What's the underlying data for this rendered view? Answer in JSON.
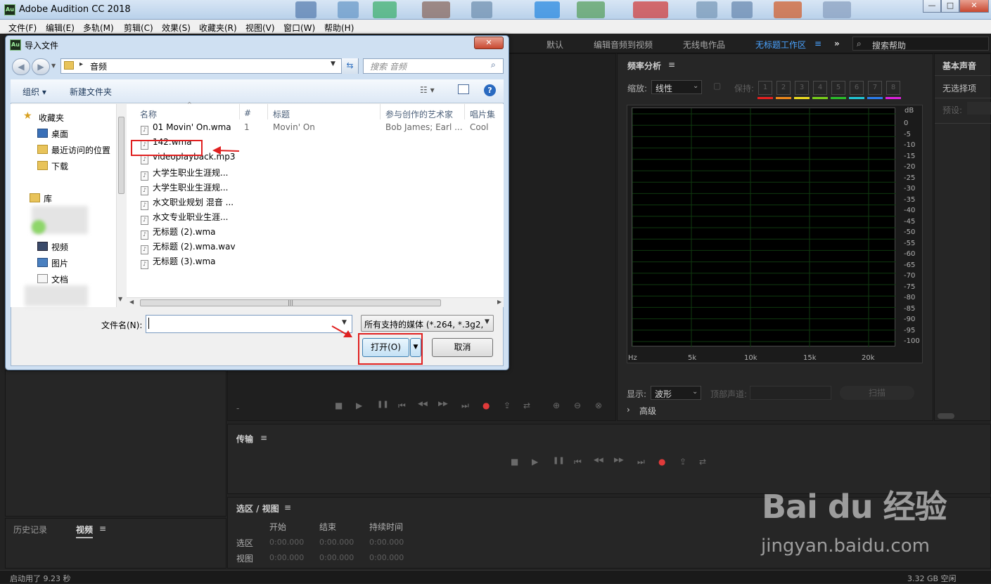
{
  "window": {
    "app_icon": "Au",
    "title": "Adobe Audition CC 2018",
    "min": "—",
    "max": "□",
    "close": "✕"
  },
  "menu": [
    "文件(F)",
    "编辑(E)",
    "多轨(M)",
    "剪辑(C)",
    "效果(S)",
    "收藏夹(R)",
    "视图(V)",
    "窗口(W)",
    "帮助(H)"
  ],
  "workspaces": {
    "items": [
      "默认",
      "编辑音频到视频",
      "无线电作品",
      "无标题工作区"
    ],
    "active_menu": "≡",
    "more": "»",
    "search_placeholder": "搜索帮助"
  },
  "freq_panel": {
    "title": "频率分析",
    "menu": "≡",
    "zoom_label": "缩放:",
    "zoom_value": "线性",
    "hold_label": "保持:",
    "hold_slots": [
      "1",
      "2",
      "3",
      "4",
      "5",
      "6",
      "7",
      "8"
    ],
    "hold_colors": [
      "#e82020",
      "#f28a1a",
      "#f0e020",
      "#7ad21a",
      "#2ac22a",
      "#20c8d8",
      "#2a7ef0",
      "#e020e0"
    ],
    "y_unit": "dB",
    "y_ticks": [
      "0",
      "-5",
      "-10",
      "-15",
      "-20",
      "-25",
      "-30",
      "-35",
      "-40",
      "-45",
      "-50",
      "-55",
      "-60",
      "-65",
      "-70",
      "-75",
      "-80",
      "-85",
      "-90",
      "-95",
      "-100"
    ],
    "x_ticks": [
      "Hz",
      "5k",
      "10k",
      "15k",
      "20k"
    ],
    "display_label": "显示:",
    "display_value": "波形",
    "top_channel_label": "顶部声道:",
    "scan_button": "扫描",
    "advanced": "高级"
  },
  "essential_panel": {
    "title": "基本声音",
    "no_selection": "无选择项",
    "preset_label": "预设:"
  },
  "transport_panel": {
    "title": "传输",
    "menu": "≡"
  },
  "selection_panel": {
    "title": "选区 / 视图",
    "menu": "≡",
    "headers": [
      "开始",
      "结束",
      "持续时间"
    ],
    "rows": [
      {
        "label": "选区",
        "start": "0:00.000",
        "end": "0:00.000",
        "duration": "0:00.000"
      },
      {
        "label": "视图",
        "start": "0:00.000",
        "end": "0:00.000",
        "duration": "0:00.000"
      }
    ]
  },
  "bottom_left": {
    "tabs": [
      "历史记录",
      "视频"
    ],
    "menu": "≡"
  },
  "status": {
    "left": "启动用了 9.23 秒",
    "right": "3.32 GB 空闲"
  },
  "transport_icons": [
    "■",
    "▶",
    "❚❚",
    "⏮",
    "◀◀",
    "▶▶",
    "⏭",
    "●",
    "⇪",
    "⇄"
  ],
  "dialog": {
    "icon": "Au",
    "title": "导入文件",
    "close": "✕",
    "breadcrumb_folder": "音频",
    "search_placeholder": "搜索 音频",
    "organize": "组织 ▾",
    "new_folder": "新建文件夹",
    "help": "?",
    "nav": {
      "favorites": "收藏夹",
      "items": [
        "桌面",
        "最近访问的位置",
        "下载"
      ],
      "library": "库",
      "lib_items": [
        "视频",
        "图片",
        "文档"
      ]
    },
    "columns": [
      "名称",
      "#",
      "标题",
      "参与创作的艺术家",
      "唱片集"
    ],
    "files": [
      {
        "name": "01 Movin' On.wma",
        "num": "1",
        "title": "Movin' On",
        "artist": "Bob James; Earl ...",
        "album": "Cool"
      },
      {
        "name": "142.wma",
        "num": "",
        "title": "",
        "artist": "",
        "album": ""
      },
      {
        "name": "videoplayback.mp3",
        "num": "",
        "title": "",
        "artist": "",
        "album": ""
      },
      {
        "name": "大学生职业生涯规...",
        "num": "",
        "title": "",
        "artist": "",
        "album": ""
      },
      {
        "name": "大学生职业生涯规...",
        "num": "",
        "title": "",
        "artist": "",
        "album": ""
      },
      {
        "name": "水文职业规划 混音 ...",
        "num": "",
        "title": "",
        "artist": "",
        "album": ""
      },
      {
        "name": "水文专业职业生涯...",
        "num": "",
        "title": "",
        "artist": "",
        "album": ""
      },
      {
        "name": "无标题 (2).wma",
        "num": "",
        "title": "",
        "artist": "",
        "album": ""
      },
      {
        "name": "无标题 (2).wma.wav",
        "num": "",
        "title": "",
        "artist": "",
        "album": ""
      },
      {
        "name": "无标题 (3).wma",
        "num": "",
        "title": "",
        "artist": "",
        "album": ""
      }
    ],
    "filename_label": "文件名(N):",
    "filename_value": "",
    "filetype": "所有支持的媒体 (*.264, *.3g2,",
    "open_button": "打开(O)",
    "cancel_button": "取消"
  },
  "watermark": {
    "brand": "Bai du 经验",
    "url": "jingyan.baidu.com"
  },
  "colors": {
    "annotation_red": "#e02020",
    "active_workspace": "#4aa3ff",
    "record_red": "#e03a3a"
  }
}
